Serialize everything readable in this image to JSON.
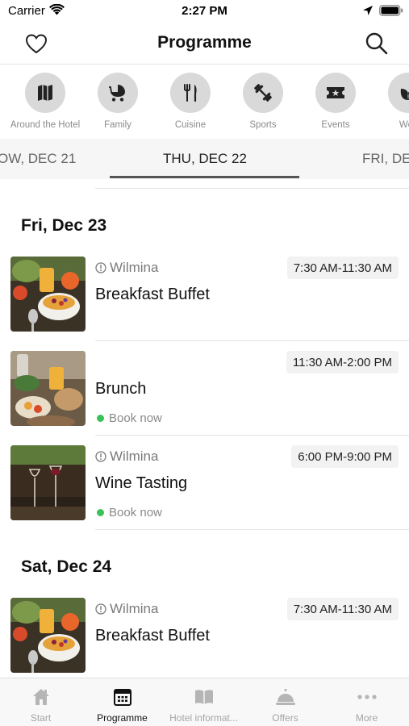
{
  "status_bar": {
    "carrier": "Carrier",
    "time": "2:27 PM"
  },
  "nav": {
    "title": "Programme"
  },
  "categories": [
    {
      "label": "Around the Hotel",
      "icon": "map-icon"
    },
    {
      "label": "Family",
      "icon": "stroller-icon"
    },
    {
      "label": "Cuisine",
      "icon": "fork-knife-icon"
    },
    {
      "label": "Sports",
      "icon": "dumbbell-icon"
    },
    {
      "label": "Events",
      "icon": "ticket-icon"
    },
    {
      "label": "Well",
      "icon": "leaf-icon"
    }
  ],
  "date_tabs": [
    {
      "label": "OW, DEC 21"
    },
    {
      "label": "THU, DEC 22",
      "active": true
    },
    {
      "label": "FRI, DE"
    }
  ],
  "days": [
    {
      "heading": "Fri, Dec 23",
      "events": [
        {
          "venue": "Wilmina",
          "time": "7:30 AM-11:30 AM",
          "title": "Breakfast Buffet",
          "book": "",
          "thumb": "breakfast"
        },
        {
          "venue": "",
          "time": "11:30 AM-2:00 PM",
          "title": "Brunch",
          "book": "Book now",
          "thumb": "brunch"
        },
        {
          "venue": "Wilmina",
          "time": "6:00 PM-9:00 PM",
          "title": "Wine Tasting",
          "book": "Book now",
          "thumb": "wine"
        }
      ]
    },
    {
      "heading": "Sat, Dec 24",
      "events": [
        {
          "venue": "Wilmina",
          "time": "7:30 AM-11:30 AM",
          "title": "Breakfast Buffet",
          "book": "",
          "thumb": "breakfast"
        }
      ]
    }
  ],
  "tab_bar": [
    {
      "label": "Start",
      "icon": "home-icon"
    },
    {
      "label": "Programme",
      "icon": "calendar-icon",
      "active": true
    },
    {
      "label": "Hotel informat...",
      "icon": "book-icon"
    },
    {
      "label": "Offers",
      "icon": "service-bell-icon"
    },
    {
      "label": "More",
      "icon": "more-dots-icon"
    }
  ],
  "colors": {
    "accent": "#3ac259",
    "icon_gray": "#d9d9d9",
    "tab_inactive": "#a5a5a5"
  }
}
